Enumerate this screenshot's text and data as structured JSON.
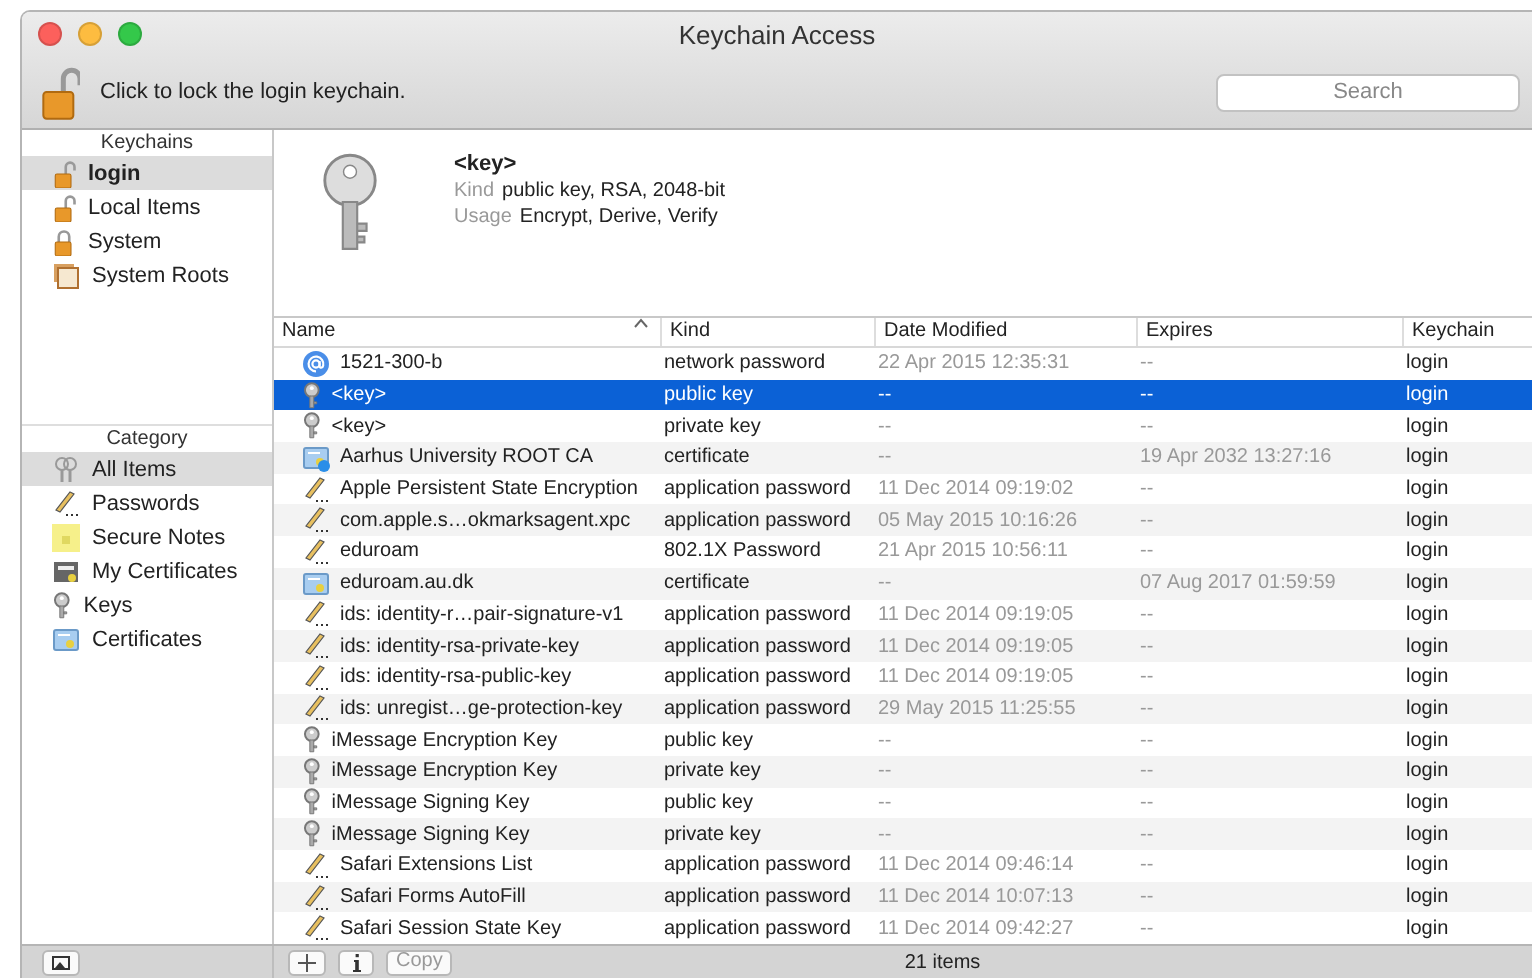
{
  "window": {
    "title": "Keychain Access"
  },
  "toolbar": {
    "lock_message": "Click to lock the login keychain.",
    "search": {
      "placeholder": "Search"
    }
  },
  "sidebar": {
    "keychains_header": "Keychains",
    "keychains": [
      {
        "label": "login",
        "kind": "unlocked",
        "selected": true
      },
      {
        "label": "Local Items",
        "kind": "unlocked",
        "selected": false
      },
      {
        "label": "System",
        "kind": "locked",
        "selected": false
      },
      {
        "label": "System Roots",
        "kind": "roots",
        "selected": false
      }
    ],
    "category_header": "Category",
    "categories": [
      {
        "label": "All Items",
        "kind": "all",
        "selected": true
      },
      {
        "label": "Passwords",
        "kind": "password",
        "selected": false
      },
      {
        "label": "Secure Notes",
        "kind": "note",
        "selected": false
      },
      {
        "label": "My Certificates",
        "kind": "mycert",
        "selected": false
      },
      {
        "label": "Keys",
        "kind": "key",
        "selected": false
      },
      {
        "label": "Certificates",
        "kind": "cert",
        "selected": false
      }
    ]
  },
  "detail": {
    "name": "<key>",
    "fields": [
      {
        "label": "Kind",
        "value": "public key, RSA, 2048-bit"
      },
      {
        "label": "Usage",
        "value": "Encrypt, Derive, Verify"
      }
    ]
  },
  "table": {
    "columns": [
      {
        "label": "Name",
        "sorted": true
      },
      {
        "label": "Kind",
        "sorted": false
      },
      {
        "label": "Date Modified",
        "sorted": false
      },
      {
        "label": "Expires",
        "sorted": false
      },
      {
        "label": "Keychain",
        "sorted": false
      }
    ],
    "rows": [
      {
        "kind": "internet",
        "selected": false,
        "cells": [
          "1521-300-b",
          "network password",
          "22 Apr 2015 12:35:31",
          "--",
          "login"
        ]
      },
      {
        "kind": "key",
        "selected": true,
        "cells": [
          "<key>",
          "public key",
          "--",
          "--",
          "login"
        ]
      },
      {
        "kind": "key",
        "selected": false,
        "cells": [
          "<key>",
          "private key",
          "--",
          "--",
          "login"
        ]
      },
      {
        "kind": "rootcert",
        "selected": false,
        "cells": [
          "Aarhus University ROOT CA",
          "certificate",
          "--",
          "19 Apr 2032 13:27:16",
          "login"
        ]
      },
      {
        "kind": "password",
        "selected": false,
        "cells": [
          "Apple Persistent State Encryption",
          "application password",
          "11 Dec 2014 09:19:02",
          "--",
          "login"
        ]
      },
      {
        "kind": "password",
        "selected": false,
        "cells": [
          "com.apple.s…okmarksagent.xpc",
          "application password",
          "05 May 2015 10:16:26",
          "--",
          "login"
        ]
      },
      {
        "kind": "password",
        "selected": false,
        "cells": [
          "eduroam",
          "802.1X Password",
          "21 Apr 2015 10:56:11",
          "--",
          "login"
        ]
      },
      {
        "kind": "cert",
        "selected": false,
        "cells": [
          "eduroam.au.dk",
          "certificate",
          "--",
          "07 Aug 2017 01:59:59",
          "login"
        ]
      },
      {
        "kind": "password",
        "selected": false,
        "cells": [
          "ids: identity-r…pair-signature-v1",
          "application password",
          "11 Dec 2014 09:19:05",
          "--",
          "login"
        ]
      },
      {
        "kind": "password",
        "selected": false,
        "cells": [
          "ids: identity-rsa-private-key",
          "application password",
          "11 Dec 2014 09:19:05",
          "--",
          "login"
        ]
      },
      {
        "kind": "password",
        "selected": false,
        "cells": [
          "ids: identity-rsa-public-key",
          "application password",
          "11 Dec 2014 09:19:05",
          "--",
          "login"
        ]
      },
      {
        "kind": "password",
        "selected": false,
        "cells": [
          "ids: unregist…ge-protection-key",
          "application password",
          "29 May 2015 11:25:55",
          "--",
          "login"
        ]
      },
      {
        "kind": "key",
        "selected": false,
        "cells": [
          "iMessage Encryption Key",
          "public key",
          "--",
          "--",
          "login"
        ]
      },
      {
        "kind": "key",
        "selected": false,
        "cells": [
          "iMessage Encryption Key",
          "private key",
          "--",
          "--",
          "login"
        ]
      },
      {
        "kind": "key",
        "selected": false,
        "cells": [
          "iMessage Signing Key",
          "public key",
          "--",
          "--",
          "login"
        ]
      },
      {
        "kind": "key",
        "selected": false,
        "cells": [
          "iMessage Signing Key",
          "private key",
          "--",
          "--",
          "login"
        ]
      },
      {
        "kind": "password",
        "selected": false,
        "cells": [
          "Safari Extensions List",
          "application password",
          "11 Dec 2014 09:46:14",
          "--",
          "login"
        ]
      },
      {
        "kind": "password",
        "selected": false,
        "cells": [
          "Safari Forms AutoFill",
          "application password",
          "11 Dec 2014 10:07:13",
          "--",
          "login"
        ]
      },
      {
        "kind": "password",
        "selected": false,
        "cells": [
          "Safari Session State Key",
          "application password",
          "11 Dec 2014 09:42:27",
          "--",
          "login"
        ]
      }
    ]
  },
  "bottom_bar": {
    "copy_button": {
      "label": "Copy",
      "disabled": true
    },
    "count": "21 items"
  }
}
